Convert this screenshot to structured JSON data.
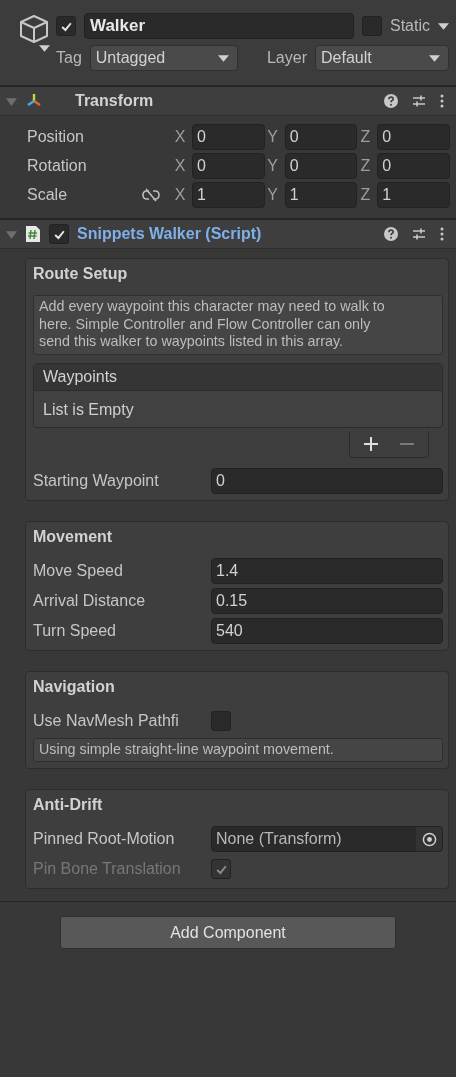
{
  "header": {
    "active": true,
    "name": "Walker",
    "static": false,
    "static_label": "Static",
    "tag_label": "Tag",
    "tag": "Untagged",
    "layer_label": "Layer",
    "layer": "Default"
  },
  "transform": {
    "title": "Transform",
    "expanded": true,
    "rows": [
      {
        "kind": "vector",
        "label": "Position",
        "axes": [
          {
            "axis": "X",
            "value": "0"
          },
          {
            "axis": "Y",
            "value": "0"
          },
          {
            "axis": "Z",
            "value": "0"
          }
        ]
      },
      {
        "kind": "vector",
        "label": "Rotation",
        "axes": [
          {
            "axis": "X",
            "value": "0"
          },
          {
            "axis": "Y",
            "value": "0"
          },
          {
            "axis": "Z",
            "value": "0"
          }
        ]
      },
      {
        "kind": "scale",
        "label": "Scale",
        "axes": [
          {
            "axis": "X",
            "value": "1"
          },
          {
            "axis": "Y",
            "value": "1"
          },
          {
            "axis": "Z",
            "value": "1"
          }
        ]
      }
    ]
  },
  "script": {
    "title": "Snippets Walker (Script)",
    "expanded": true,
    "enabled": true,
    "groups": [
      {
        "title": "Route Setup",
        "items": [
          {
            "kind": "help",
            "text": "Add every waypoint this character may need to walk to here. Simple Controller and Flow Controller can only send this walker to waypoints listed in this array."
          },
          {
            "kind": "list",
            "title": "Waypoints",
            "empty_text": "List is Empty"
          },
          {
            "kind": "field",
            "label": "Starting Waypoint",
            "value": "0"
          }
        ]
      },
      {
        "title": "Movement",
        "items": [
          {
            "kind": "field",
            "label": "Move Speed",
            "value": "1.4"
          },
          {
            "kind": "field",
            "label": "Arrival Distance",
            "value": "0.15"
          },
          {
            "kind": "field",
            "label": "Turn Speed",
            "value": "540"
          }
        ]
      },
      {
        "title": "Navigation",
        "items": [
          {
            "kind": "toggle",
            "label": "Use NavMesh Pathfi",
            "checked": false,
            "disabled": false
          },
          {
            "kind": "help",
            "text": "Using simple straight-line waypoint movement."
          }
        ]
      },
      {
        "title": "Anti-Drift",
        "items": [
          {
            "kind": "object",
            "label": "Pinned Root-Motion",
            "value": "None (Transform)"
          },
          {
            "kind": "toggle",
            "label": "Pin Bone Translation",
            "checked": true,
            "disabled": true
          }
        ]
      }
    ]
  },
  "add_component": "Add Component"
}
